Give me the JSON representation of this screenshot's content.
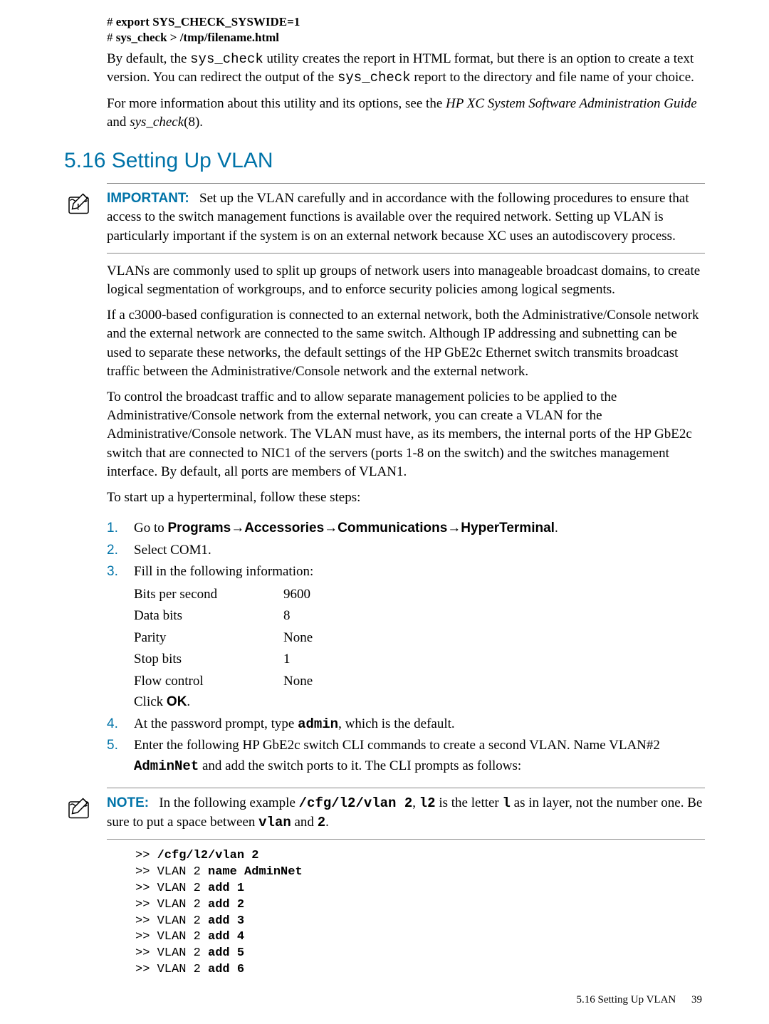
{
  "code_top": {
    "line1_prefix": "# ",
    "line1_cmd": "export SYS_CHECK_SYSWIDE=1",
    "line2_prefix": "# ",
    "line2_cmd": "sys_check > /tmp/filename.html"
  },
  "para1a": "By default, the ",
  "para1_code1": "sys_check",
  "para1b": " utility creates the report in HTML format, but there is an option to create a text version. You can redirect the output of the ",
  "para1_code2": "sys_check",
  "para1c": " report to the directory and file name of your choice.",
  "para2a": "For more information about this utility and its options, see the ",
  "para2_ital1": "HP XC System Software Administration Guide",
  "para2b": " and ",
  "para2_ital2": "sys_check",
  "para2c": "(8).",
  "heading": "5.16 Setting Up VLAN",
  "important": {
    "label": "IMPORTANT:",
    "text": "Set up the VLAN carefully and in accordance with the following procedures to ensure that access to the switch management functions is available over the required network. Setting up VLAN is particularly important if the system is on an external network because XC uses an autodiscovery process."
  },
  "para3": "VLANs are commonly used to split up groups of network users into manageable broadcast domains, to create logical segmentation of workgroups, and to enforce security policies among logical segments.",
  "para4": "If a c3000-based configuration is connected to an external network, both the Administrative/Console network and the external network are connected to the same switch. Although IP addressing and subnetting can be used to separate these networks, the default settings of the HP GbE2c Ethernet switch transmits broadcast traffic between the Administrative/Console network and the external network.",
  "para5": "To control the broadcast traffic and to allow separate management policies to be applied to the Administrative/Console network from the external network, you can create a VLAN for the Administrative/Console network. The VLAN must have, as its members, the internal ports of the HP GbE2c switch that are connected to NIC1 of the servers (ports 1-8 on the switch) and the switches management interface. By default, all ports are members of VLAN1.",
  "para6": "To start up a hyperterminal, follow these steps:",
  "step1": {
    "num": "1.",
    "pre": "Go to ",
    "p1": "Programs",
    "p2": "Accessories",
    "p3": "Communications",
    "p4": "HyperTerminal",
    "post": "."
  },
  "step2": {
    "num": "2.",
    "text": "Select COM1."
  },
  "step3": {
    "num": "3.",
    "intro": "Fill in the following information:",
    "rows": [
      {
        "k": "Bits per second",
        "v": "9600"
      },
      {
        "k": "Data bits",
        "v": "8"
      },
      {
        "k": "Parity",
        "v": "None"
      },
      {
        "k": "Stop bits",
        "v": "1"
      },
      {
        "k": "Flow control",
        "v": "None"
      }
    ],
    "click_pre": "Click ",
    "click_btn": "OK",
    "click_post": "."
  },
  "step4": {
    "num": "4.",
    "a": "At the password prompt, type ",
    "cmd": "admin",
    "b": ", which is the default."
  },
  "step5": {
    "num": "5.",
    "a": "Enter the following HP GbE2c switch CLI commands to create a second VLAN. Name VLAN#2 ",
    "cmd": "AdminNet",
    "b": " and add the switch ports to it. The CLI prompts as follows:"
  },
  "note": {
    "label": "NOTE:",
    "a": "In the following example ",
    "c1": "/cfg/l2/vlan 2",
    "b": ", ",
    "c2": "l2",
    "c": " is the letter ",
    "c3": "l",
    "d": " as in layer, not the number one. Be sure to put a space between ",
    "c4": "vlan",
    "e": " and ",
    "c5": "2",
    "f": "."
  },
  "cli": [
    {
      "prompt": ">> ",
      "bold": "/cfg/l2/vlan 2"
    },
    {
      "prompt": ">> VLAN 2 ",
      "bold": "name AdminNet"
    },
    {
      "prompt": ">> VLAN 2 ",
      "bold": "add 1"
    },
    {
      "prompt": ">> VLAN 2 ",
      "bold": "add 2"
    },
    {
      "prompt": ">> VLAN 2 ",
      "bold": "add 3"
    },
    {
      "prompt": ">> VLAN 2 ",
      "bold": "add 4"
    },
    {
      "prompt": ">> VLAN 2 ",
      "bold": "add 5"
    },
    {
      "prompt": ">> VLAN 2 ",
      "bold": "add 6"
    }
  ],
  "footer": {
    "section": "5.16 Setting Up VLAN",
    "page": "39"
  },
  "arrow": "→"
}
